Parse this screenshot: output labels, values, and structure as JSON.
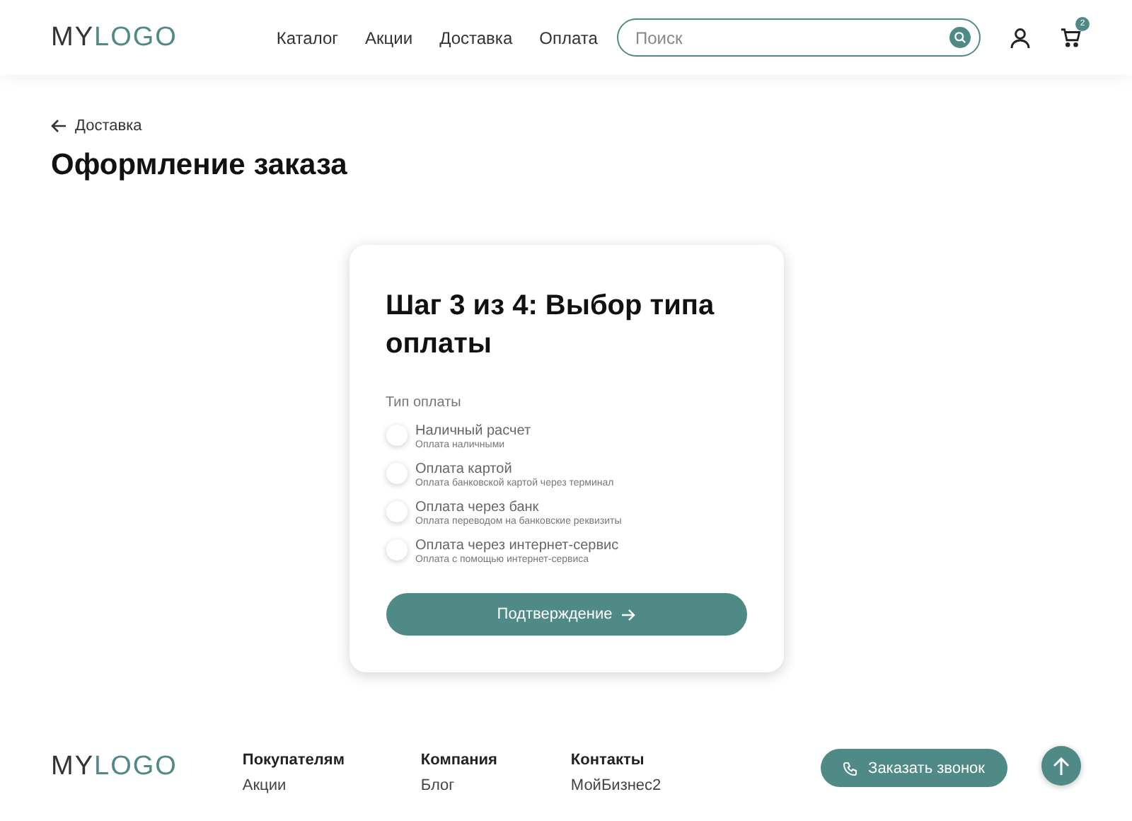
{
  "header": {
    "logo": {
      "dark": "MY",
      "light": "LOGO"
    },
    "nav": [
      "Каталог",
      "Акции",
      "Доставка",
      "Оплата"
    ],
    "search": {
      "placeholder": "Поиск"
    },
    "cart_count": "2"
  },
  "back_link": "Доставка",
  "title": "Оформление заказа",
  "form": {
    "heading": "Шаг 3 из 4: Выбор типа оплаты",
    "group_label": "Тип оплаты",
    "options": [
      {
        "label": "Наличный расчет",
        "hint": "Оплата наличными",
        "selected": false
      },
      {
        "label": "Оплата картой",
        "hint": "Оплата банковской картой через терминал",
        "selected": false
      },
      {
        "label": "Оплата через банк",
        "hint": "Оплата переводом на банковские реквизиты",
        "selected": false
      },
      {
        "label": "Оплата через интернет-сервис",
        "hint": "Оплата с помощью интернет-сервиса",
        "selected": false
      }
    ],
    "submit": "Подтверждение"
  },
  "footer": {
    "logo": {
      "dark": "MY",
      "light": "LOGO"
    },
    "columns": [
      {
        "title": "Покупателям",
        "items": [
          "Акции"
        ]
      },
      {
        "title": "Компания",
        "items": [
          "Блог"
        ]
      },
      {
        "title": "Контакты",
        "items": [
          "МойБизнес2"
        ]
      }
    ],
    "callback": "Заказать звонок"
  }
}
